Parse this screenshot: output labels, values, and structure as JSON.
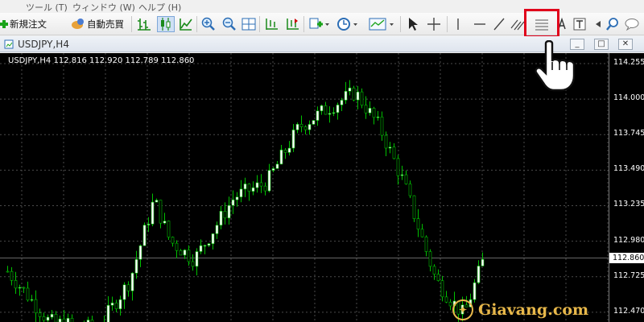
{
  "menu": {
    "items": [
      "ツール (T)",
      "ウィンドウ (W)",
      "ヘルプ (H)"
    ]
  },
  "toolbar": {
    "new_order_label": "新規注文",
    "autotrade_label": "自動売買"
  },
  "window": {
    "title": "USDJPY,H4"
  },
  "chart_data": {
    "type": "candlestick",
    "header": "USDJPY,H4  112.816 112.920 112.789 112.860",
    "price_ticks": [
      "114.255",
      "114.000",
      "113.745",
      "113.490",
      "113.235",
      "112.980",
      "112.725",
      "112.470"
    ],
    "current_price": "112.860",
    "ylim": [
      112.4,
      114.33
    ],
    "grid": true,
    "colors": {
      "background": "#000000",
      "bull": "#ffffff",
      "bear": "#000000",
      "wick": "#00c000",
      "grid": "#4a4a4a"
    }
  },
  "watermark": {
    "text": "Giavang.com"
  }
}
